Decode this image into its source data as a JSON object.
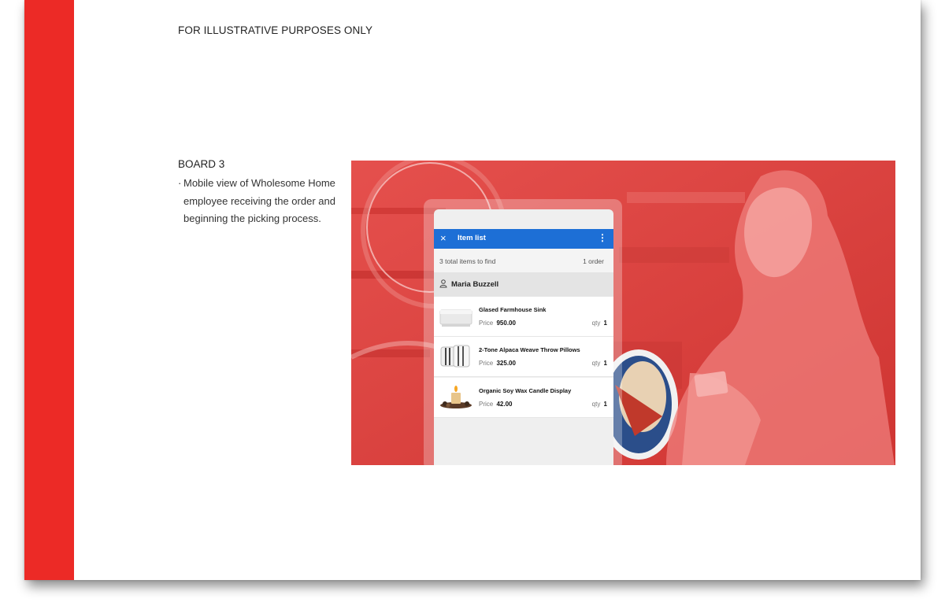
{
  "disclaimer": "FOR ILLUSTRATIVE PURPOSES ONLY",
  "board": {
    "title": "BOARD 3",
    "bullet": "·",
    "description": "Mobile view of Wholesome Home employee receiving the order and beginning the picking process."
  },
  "colors": {
    "accent_red": "#ec2a26",
    "app_bar_blue": "#1d6fd6"
  },
  "app": {
    "close_icon": "×",
    "title": "Item list",
    "menu_icon": "⋮",
    "summary_left": "3 total items to find",
    "summary_right": "1 order",
    "customer_name": "Maria Buzzell",
    "price_label": "Price",
    "qty_label": "qty",
    "items": [
      {
        "name": "Glased Farmhouse Sink",
        "price": "950.00",
        "qty": "1",
        "icon": "sink-image"
      },
      {
        "name": "2-Tone Alpaca Weave Throw Pillows",
        "price": "325.00",
        "qty": "1",
        "icon": "pillows-image"
      },
      {
        "name": "Organic Soy Wax Candle Display",
        "price": "42.00",
        "qty": "1",
        "icon": "candle-image"
      }
    ]
  }
}
